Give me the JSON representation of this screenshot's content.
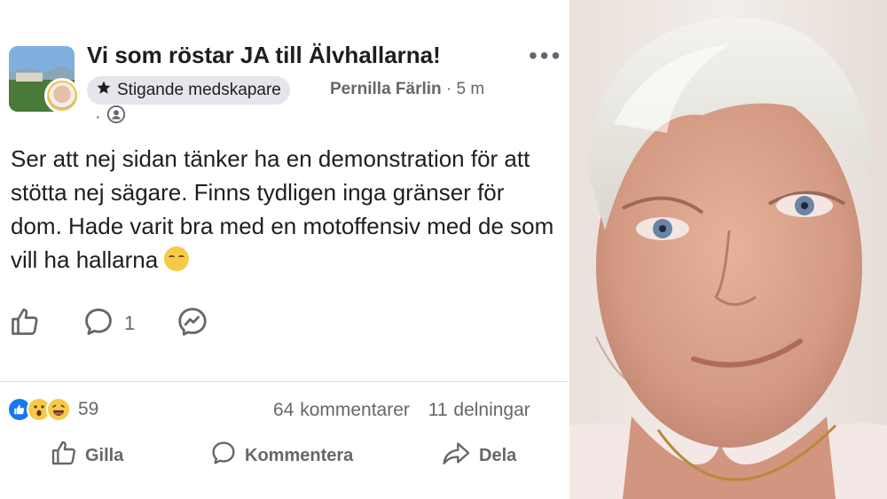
{
  "post": {
    "group_name": "Vi som röstar JA till Älvhallarna!",
    "badge_label": "Stigande medskapare",
    "author": "Pernilla Färlin",
    "time_separator": "·",
    "time": "5 m",
    "privacy_separator": "·",
    "body": "Ser att nej sidan tänker ha en demonstration för att stötta nej sägare. Finns tydligen inga gränser för dom. Hade varit bra med en motoffensiv med de som vill ha hallarna",
    "comment_count_inline": "1"
  },
  "footer": {
    "reaction_count": "59",
    "comments": "64 kommentarer",
    "shares": "11 delningar",
    "like_label": "Gilla",
    "comment_label": "Kommentera",
    "share_label": "Dela"
  },
  "icons": {
    "more": "more-icon",
    "star": "star-icon",
    "privacy": "friends-icon",
    "like": "thumbs-up-icon",
    "comment": "comment-icon",
    "messenger": "messenger-icon",
    "share": "share-icon"
  },
  "colors": {
    "text": "#1c1e21",
    "muted": "#65676b",
    "like_blue": "#1877f2",
    "emoji_yellow": "#f7c948",
    "badge_bg": "#e4e6eb"
  }
}
